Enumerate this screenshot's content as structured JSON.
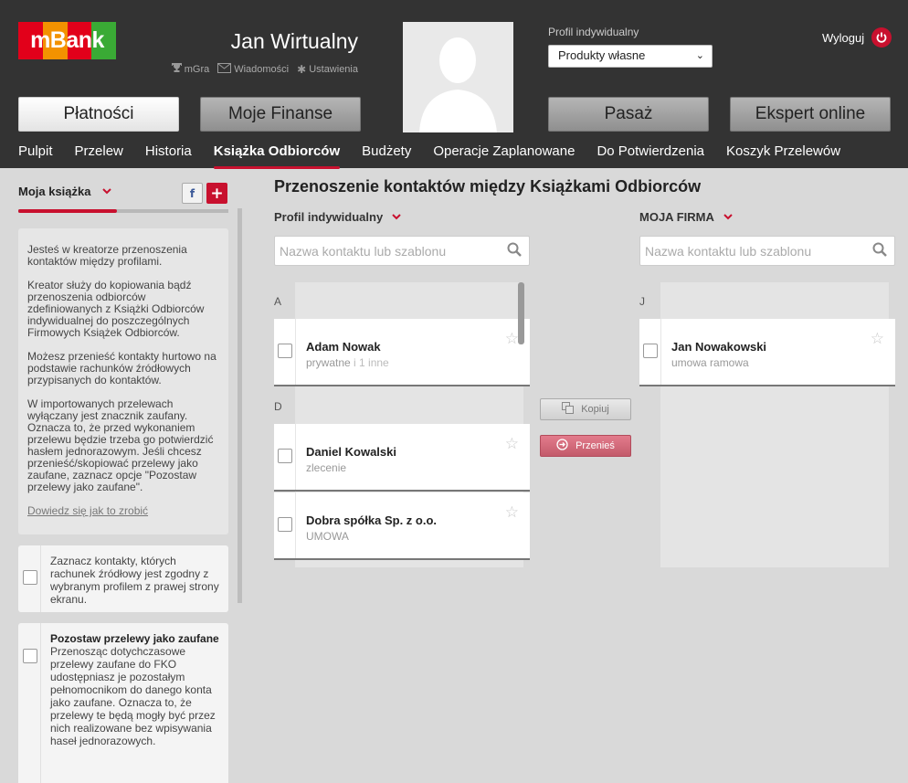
{
  "header": {
    "logo_text": "mBank",
    "user_name": "Jan Wirtualny",
    "links": [
      {
        "label": "mGra",
        "icon": "trophy-icon"
      },
      {
        "label": "Wiadomości",
        "icon": "envelope-icon"
      },
      {
        "label": "Ustawienia",
        "icon": "gear-icon"
      }
    ],
    "profile_label": "Profil indywidualny",
    "profile_select": "Produkty własne",
    "logout_label": "Wyloguj"
  },
  "main_nav": [
    {
      "label": "Płatności",
      "active": true
    },
    {
      "label": "Moje Finanse",
      "active": false
    },
    {
      "label": "Pasaż",
      "active": false
    },
    {
      "label": "Ekspert online",
      "active": false
    }
  ],
  "sub_nav": [
    {
      "label": "Pulpit",
      "active": false
    },
    {
      "label": "Przelew",
      "active": false
    },
    {
      "label": "Historia",
      "active": false
    },
    {
      "label": "Książka Odbiorców",
      "active": true
    },
    {
      "label": "Budżety",
      "active": false
    },
    {
      "label": "Operacje Zaplanowane",
      "active": false
    },
    {
      "label": "Do Potwierdzenia",
      "active": false
    },
    {
      "label": "Koszyk Przelewów",
      "active": false
    }
  ],
  "sidebar": {
    "title": "Moja książka",
    "fb_icon_label": "f",
    "add_label": "+",
    "progress_fraction": 0.47,
    "info_paragraphs": [
      "Jesteś w kreatorze przenoszenia kontaktów między profilami.",
      "Kreator służy do kopiowania bądź przenoszenia odbiorców zdefiniowanych z Książki Odbiorców indywidualnej do poszczególnych Firmowych Książek Odbiorców.",
      "Możesz przenieść kontakty hurtowo na podstawie rachunków źródłowych przypisanych do kontaktów.",
      "W importowanych przelewach wyłączany jest znacznik zaufany. Oznacza to, że przed wykonaniem przelewu będzie trzeba go potwierdzić hasłem jednorazowym. Jeśli chcesz przenieść/skopiować przelewy jako zaufane, zaznacz opcje \"Pozostaw przelewy jako zaufane\"."
    ],
    "help_link": "Dowiedz się jak to zrobić",
    "option1_text": "Zaznacz kontakty, których rachunek źródłowy jest zgodny z wybranym profilem z prawej strony ekranu.",
    "option2_title": "Pozostaw przelewy jako zaufane",
    "option2_text": "Przenosząc dotychczasowe przelewy zaufane do FKO udostępniasz je pozostałym pełnomocnikom do danego konta jako zaufane. Oznacza to, że przelewy te będą mogły być przez nich realizowane bez wpisywania haseł jednorazowych."
  },
  "page_title": "Przenoszenie kontaktów między Książkami Odbiorców",
  "left_column": {
    "header": "Profil indywidualny",
    "search_placeholder": "Nazwa kontaktu lub szablonu",
    "groups": [
      {
        "letter": "A",
        "contacts": [
          {
            "name": "Adam Nowak",
            "sub": "prywatne",
            "extra": " i 1 inne"
          }
        ]
      },
      {
        "letter": "D",
        "contacts": [
          {
            "name": "Daniel Kowalski",
            "sub": "zlecenie",
            "extra": ""
          },
          {
            "name": "Dobra spółka Sp. z o.o.",
            "sub": "UMOWA",
            "extra": ""
          }
        ]
      }
    ]
  },
  "right_column": {
    "header": "MOJA FIRMA",
    "search_placeholder": "Nazwa kontaktu lub szablonu",
    "groups": [
      {
        "letter": "J",
        "contacts": [
          {
            "name": "Jan Nowakowski",
            "sub": "umowa ramowa",
            "extra": ""
          }
        ]
      }
    ]
  },
  "actions": {
    "copy": "Kopiuj",
    "move": "Przenieś"
  },
  "colors": {
    "accent": "#c8102e",
    "header_bg": "#333333",
    "page_bg": "#d9d9d9"
  }
}
